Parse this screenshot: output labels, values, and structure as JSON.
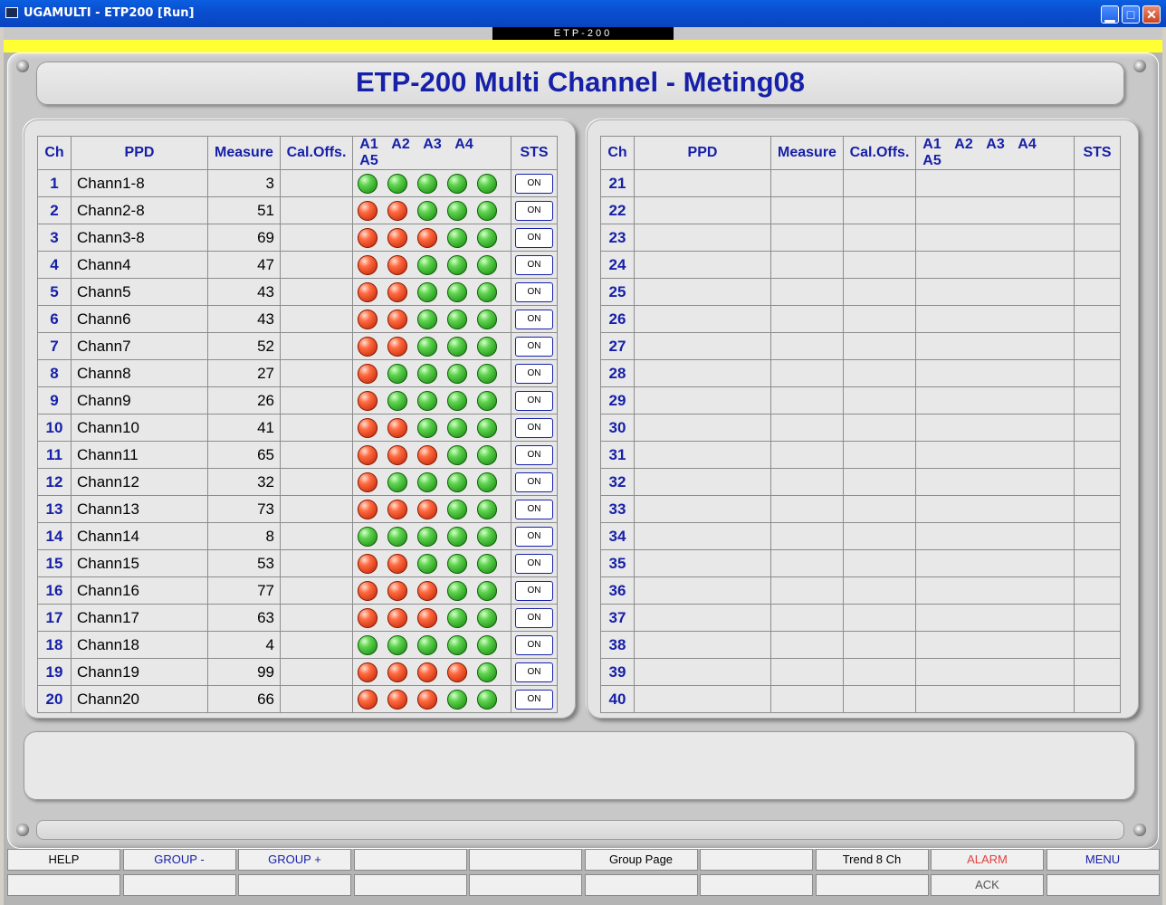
{
  "window": {
    "title": "UGAMULTI - ETP200 [Run]"
  },
  "device_label": "ETP-200",
  "header": {
    "title": "ETP-200 Multi Channel  -  Meting08"
  },
  "columns": [
    "Ch",
    "PPD",
    "Measure",
    "Cal.Offs.",
    "A1",
    "A2",
    "A3",
    "A4",
    "A5",
    "STS"
  ],
  "left_rows": [
    {
      "ch": "1",
      "ppd": "Chann1-8",
      "measure": "3",
      "cal": "",
      "alarms": [
        "green",
        "green",
        "green",
        "green",
        "green"
      ],
      "sts": "ON"
    },
    {
      "ch": "2",
      "ppd": "Chann2-8",
      "measure": "51",
      "cal": "",
      "alarms": [
        "red",
        "red",
        "green",
        "green",
        "green"
      ],
      "sts": "ON"
    },
    {
      "ch": "3",
      "ppd": "Chann3-8",
      "measure": "69",
      "cal": "",
      "alarms": [
        "red",
        "red",
        "red",
        "green",
        "green"
      ],
      "sts": "ON"
    },
    {
      "ch": "4",
      "ppd": "Chann4",
      "measure": "47",
      "cal": "",
      "alarms": [
        "red",
        "red",
        "green",
        "green",
        "green"
      ],
      "sts": "ON"
    },
    {
      "ch": "5",
      "ppd": "Chann5",
      "measure": "43",
      "cal": "",
      "alarms": [
        "red",
        "red",
        "green",
        "green",
        "green"
      ],
      "sts": "ON"
    },
    {
      "ch": "6",
      "ppd": "Chann6",
      "measure": "43",
      "cal": "",
      "alarms": [
        "red",
        "red",
        "green",
        "green",
        "green"
      ],
      "sts": "ON"
    },
    {
      "ch": "7",
      "ppd": "Chann7",
      "measure": "52",
      "cal": "",
      "alarms": [
        "red",
        "red",
        "green",
        "green",
        "green"
      ],
      "sts": "ON"
    },
    {
      "ch": "8",
      "ppd": "Chann8",
      "measure": "27",
      "cal": "",
      "alarms": [
        "red",
        "green",
        "green",
        "green",
        "green"
      ],
      "sts": "ON"
    },
    {
      "ch": "9",
      "ppd": "Chann9",
      "measure": "26",
      "cal": "",
      "alarms": [
        "red",
        "green",
        "green",
        "green",
        "green"
      ],
      "sts": "ON"
    },
    {
      "ch": "10",
      "ppd": "Chann10",
      "measure": "41",
      "cal": "",
      "alarms": [
        "red",
        "red",
        "green",
        "green",
        "green"
      ],
      "sts": "ON"
    },
    {
      "ch": "11",
      "ppd": "Chann11",
      "measure": "65",
      "cal": "",
      "alarms": [
        "red",
        "red",
        "red",
        "green",
        "green"
      ],
      "sts": "ON"
    },
    {
      "ch": "12",
      "ppd": "Chann12",
      "measure": "32",
      "cal": "",
      "alarms": [
        "red",
        "green",
        "green",
        "green",
        "green"
      ],
      "sts": "ON"
    },
    {
      "ch": "13",
      "ppd": "Chann13",
      "measure": "73",
      "cal": "",
      "alarms": [
        "red",
        "red",
        "red",
        "green",
        "green"
      ],
      "sts": "ON"
    },
    {
      "ch": "14",
      "ppd": "Chann14",
      "measure": "8",
      "cal": "",
      "alarms": [
        "green",
        "green",
        "green",
        "green",
        "green"
      ],
      "sts": "ON"
    },
    {
      "ch": "15",
      "ppd": "Chann15",
      "measure": "53",
      "cal": "",
      "alarms": [
        "red",
        "red",
        "green",
        "green",
        "green"
      ],
      "sts": "ON"
    },
    {
      "ch": "16",
      "ppd": "Chann16",
      "measure": "77",
      "cal": "",
      "alarms": [
        "red",
        "red",
        "red",
        "green",
        "green"
      ],
      "sts": "ON"
    },
    {
      "ch": "17",
      "ppd": "Chann17",
      "measure": "63",
      "cal": "",
      "alarms": [
        "red",
        "red",
        "red",
        "green",
        "green"
      ],
      "sts": "ON"
    },
    {
      "ch": "18",
      "ppd": "Chann18",
      "measure": "4",
      "cal": "",
      "alarms": [
        "green",
        "green",
        "green",
        "green",
        "green"
      ],
      "sts": "ON"
    },
    {
      "ch": "19",
      "ppd": "Chann19",
      "measure": "99",
      "cal": "",
      "alarms": [
        "red",
        "red",
        "red",
        "red",
        "green"
      ],
      "sts": "ON"
    },
    {
      "ch": "20",
      "ppd": "Chann20",
      "measure": "66",
      "cal": "",
      "alarms": [
        "red",
        "red",
        "red",
        "green",
        "green"
      ],
      "sts": "ON"
    }
  ],
  "right_rows": [
    {
      "ch": "21"
    },
    {
      "ch": "22"
    },
    {
      "ch": "23"
    },
    {
      "ch": "24"
    },
    {
      "ch": "25"
    },
    {
      "ch": "26"
    },
    {
      "ch": "27"
    },
    {
      "ch": "28"
    },
    {
      "ch": "29"
    },
    {
      "ch": "30"
    },
    {
      "ch": "31"
    },
    {
      "ch": "32"
    },
    {
      "ch": "33"
    },
    {
      "ch": "34"
    },
    {
      "ch": "35"
    },
    {
      "ch": "36"
    },
    {
      "ch": "37"
    },
    {
      "ch": "38"
    },
    {
      "ch": "39"
    },
    {
      "ch": "40"
    }
  ],
  "fkeys_top": [
    {
      "label": "HELP",
      "color": "#000000"
    },
    {
      "label": "GROUP -",
      "color": "#1620a8"
    },
    {
      "label": "GROUP +",
      "color": "#1620a8"
    },
    {
      "label": "",
      "color": "#000000"
    },
    {
      "label": "",
      "color": "#000000"
    },
    {
      "label": "Group Page",
      "color": "#000000"
    },
    {
      "label": "",
      "color": "#000000"
    },
    {
      "label": "Trend 8 Ch",
      "color": "#000000"
    },
    {
      "label": "ALARM",
      "color": "#e04040"
    },
    {
      "label": "MENU",
      "color": "#1620a8"
    }
  ],
  "fkeys_bottom": [
    {
      "label": "",
      "color": "#000000"
    },
    {
      "label": "",
      "color": "#000000"
    },
    {
      "label": "",
      "color": "#000000"
    },
    {
      "label": "",
      "color": "#000000"
    },
    {
      "label": "",
      "color": "#000000"
    },
    {
      "label": "",
      "color": "#000000"
    },
    {
      "label": "",
      "color": "#000000"
    },
    {
      "label": "",
      "color": "#000000"
    },
    {
      "label": "ACK",
      "color": "#555555"
    },
    {
      "label": "",
      "color": "#000000"
    }
  ],
  "colors": {
    "accent_blue": "#1620a8",
    "alarm_green": "#2aa61e",
    "alarm_red": "#e0401a",
    "status_yellow": "#ffff33"
  }
}
